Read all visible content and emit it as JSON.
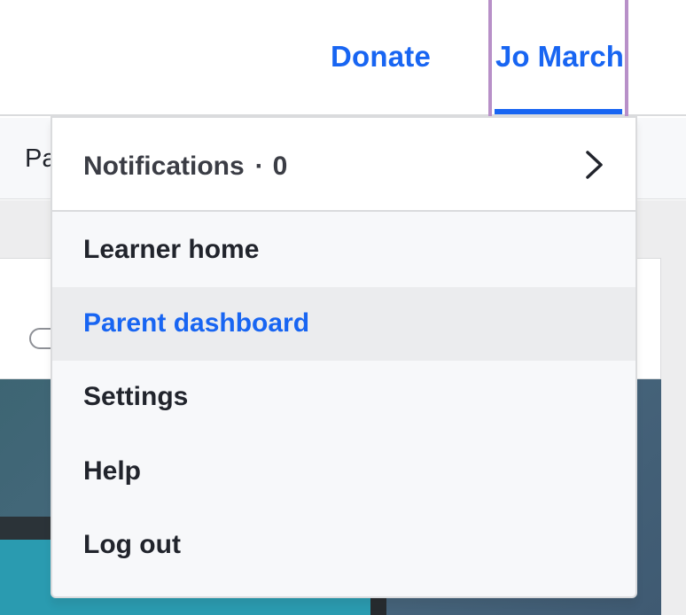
{
  "header": {
    "donate_label": "Donate",
    "user_name": "Jo March"
  },
  "page": {
    "subheader_label": "Pa"
  },
  "menu": {
    "notifications_label": "Notifications",
    "notifications_separator": "·",
    "notifications_count": "0",
    "items": [
      {
        "label": "Learner home"
      },
      {
        "label": "Parent dashboard",
        "selected": true
      },
      {
        "label": "Settings"
      },
      {
        "label": "Help"
      },
      {
        "label": "Log out"
      }
    ]
  },
  "colors": {
    "accent": "#1865f2",
    "focus_outline": "#b890c8"
  },
  "icons": {
    "notifications_arrow": "chevron-right-icon"
  }
}
